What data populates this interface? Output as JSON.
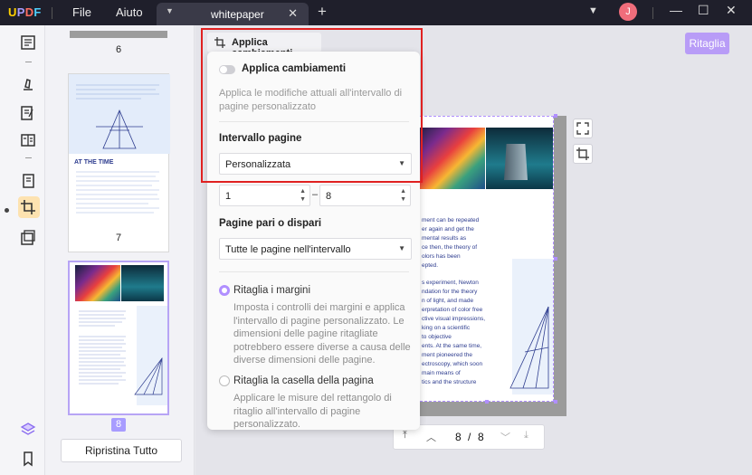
{
  "app": {
    "logo": "UPDF",
    "menu": [
      "File",
      "Aiuto"
    ],
    "tab_title": "whitepaper",
    "user_initial": "J"
  },
  "thumbnails": {
    "labels": [
      "6",
      "7",
      "8"
    ],
    "reset_label": "Ripristina Tutto",
    "page7_heading": "AT THE TIME",
    "active_page": 8
  },
  "toolbar": {
    "crop_button": "Ritaglia"
  },
  "panel": {
    "apply_tab_label": "Applica cambiamenti",
    "apply_title": "Applica cambiamenti",
    "apply_desc": "Applica le modifiche attuali all'intervallo di pagine personalizzato",
    "apply_enabled": false,
    "range_title": "Intervallo pagine",
    "range_value": "Personalizzata",
    "from_page": "1",
    "range_sep": "–",
    "to_page": "8",
    "parity_title": "Pagine pari o dispari",
    "parity_value": "Tutte le pagine nell'intervallo",
    "option1_title": "Ritaglia i margini",
    "option1_desc": "Imposta i controlli dei margini e applica l'intervallo di pagine personalizzato. Le dimensioni delle pagine ritagliate potrebbero essere diverse a causa delle diverse dimensioni delle pagine.",
    "option2_title": "Ritaglia la casella della pagina",
    "option2_desc": "Applicare le misure del rettangolo di ritaglio all'intervallo di pagine personalizzato."
  },
  "pager": {
    "current": "8",
    "separator": "/",
    "total": "8"
  },
  "document": {
    "lines": [
      "ment can be repeated",
      "er again and get the",
      "mental results as",
      "ce then, the theory of",
      "olors has been",
      "epted.",
      "s experiment, Newton",
      "ndation for the theory",
      "n of light, and made",
      "erpretation of color free",
      "ctive visual impressions,",
      "king on a scientific",
      "to objective",
      "ents. At the same time,",
      "ment pioneered the",
      "ectroscopy, which soon",
      "main means of",
      "tics and the structure"
    ]
  },
  "colors": {
    "accent": "#b08fff",
    "highlight": "#e02121",
    "titlebar": "#1f1f2b"
  }
}
